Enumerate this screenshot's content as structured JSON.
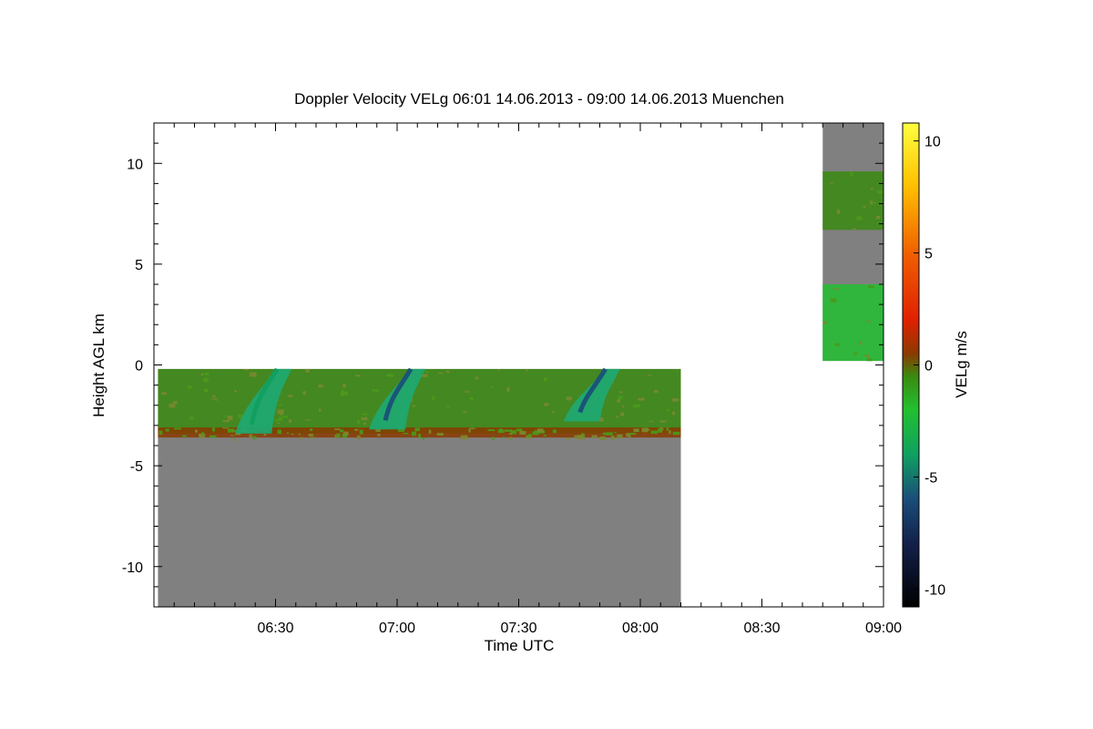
{
  "chart_data": {
    "type": "heatmap",
    "title": "Doppler Velocity VELg   06:01 14.06.2013 - 09:00 14.06.2013 Muenchen",
    "xlabel": "Time UTC",
    "ylabel": "Height AGL km",
    "colorbar_label": "VELg m/s",
    "x_range": [
      "06:01",
      "09:00"
    ],
    "y_range": [
      -12,
      12
    ],
    "x_ticks": [
      {
        "label": "06:30",
        "minutes": 30
      },
      {
        "label": "07:00",
        "minutes": 60
      },
      {
        "label": "07:30",
        "minutes": 90
      },
      {
        "label": "08:00",
        "minutes": 120
      },
      {
        "label": "08:30",
        "minutes": 150
      },
      {
        "label": "09:00",
        "minutes": 180
      }
    ],
    "y_ticks": [
      10,
      5,
      0,
      -5,
      -10
    ],
    "colorbar_range": [
      -10.8,
      10.8
    ],
    "colorbar_ticks": [
      10,
      5,
      0,
      -5,
      -10
    ],
    "colormap": [
      {
        "v": -10.8,
        "color": "#000000"
      },
      {
        "v": -8,
        "color": "#12204a"
      },
      {
        "v": -6,
        "color": "#1a4d7a"
      },
      {
        "v": -4,
        "color": "#10a060"
      },
      {
        "v": -2,
        "color": "#22c030"
      },
      {
        "v": -0.5,
        "color": "#3a8a10"
      },
      {
        "v": 0.5,
        "color": "#8a3a00"
      },
      {
        "v": 2,
        "color": "#e02000"
      },
      {
        "v": 5,
        "color": "#f06000"
      },
      {
        "v": 8,
        "color": "#ffc000"
      },
      {
        "v": 10.8,
        "color": "#ffff40"
      }
    ],
    "no_signal_color": "#808080",
    "segments": [
      {
        "start": "06:01",
        "end": "08:10",
        "height_range": [
          -12,
          -0.2
        ],
        "layers": [
          {
            "height_range": [
              -3.4,
              -0.2
            ],
            "velocity": -1
          },
          {
            "height_range": [
              -3.6,
              -3.1
            ],
            "velocity": 1
          }
        ],
        "fall_streaks": [
          {
            "time": "06:25",
            "height_range": [
              -3.4,
              -0.2
            ],
            "velocity": -4
          },
          {
            "time": "06:58",
            "height_range": [
              -3.2,
              -0.2
            ],
            "velocity": -5
          },
          {
            "time": "07:46",
            "height_range": [
              -2.8,
              -0.2
            ],
            "velocity": -6
          }
        ]
      },
      {
        "start": "08:45",
        "end": "09:00",
        "height_range": [
          0.2,
          12
        ],
        "layers": [
          {
            "height_range": [
              6.7,
              9.6
            ],
            "velocity": -1
          },
          {
            "height_range": [
              0.2,
              4.0
            ],
            "velocity": -2
          }
        ]
      }
    ]
  }
}
